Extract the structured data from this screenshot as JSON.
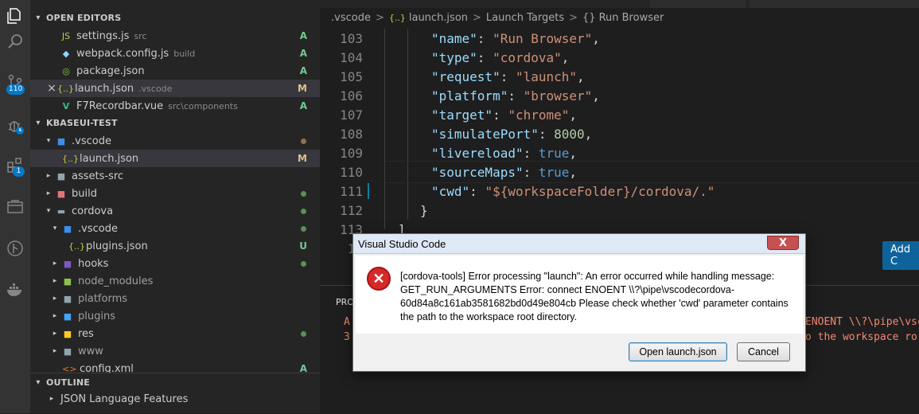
{
  "activity_bar": {
    "scm_badge": "110",
    "extensions_badge": "1"
  },
  "sidebar": {
    "open_editors": {
      "title": "OPEN EDITORS",
      "items": [
        {
          "name": "settings.js",
          "desc": "src",
          "status": "A",
          "icon": "js-file-icon"
        },
        {
          "name": "webpack.config.js",
          "desc": "build",
          "status": "A",
          "icon": "webpack-file-icon"
        },
        {
          "name": "package.json",
          "desc": "",
          "status": "A",
          "icon": "npm-file-icon"
        },
        {
          "name": "launch.json",
          "desc": ".vscode",
          "status": "M",
          "icon": "json-file-icon",
          "close": "×"
        },
        {
          "name": "F7Recordbar.vue",
          "desc": "src\\components",
          "status": "A",
          "icon": "vue-file-icon"
        }
      ]
    },
    "explorer": {
      "title": "KBASEUI-TEST",
      "items": [
        {
          "name": ".vscode",
          "status": "",
          "icon": "vscode-folder-icon"
        },
        {
          "name": "launch.json",
          "status": "M",
          "icon": "json-file-icon"
        },
        {
          "name": "assets-src",
          "status": "",
          "icon": "folder-icon"
        },
        {
          "name": "build",
          "status": "",
          "icon": "build-folder-icon"
        },
        {
          "name": "cordova",
          "status": "",
          "icon": "folder-open-icon"
        },
        {
          "name": ".vscode",
          "status": "",
          "icon": "vscode-folder-icon"
        },
        {
          "name": "plugins.json",
          "status": "U",
          "icon": "json-file-icon"
        },
        {
          "name": "hooks",
          "status": "",
          "icon": "hooks-folder-icon"
        },
        {
          "name": "node_modules",
          "status": "",
          "icon": "node-folder-icon"
        },
        {
          "name": "platforms",
          "status": "",
          "icon": "folder-icon"
        },
        {
          "name": "plugins",
          "status": "",
          "icon": "plugins-folder-icon"
        },
        {
          "name": "res",
          "status": "",
          "icon": "res-folder-icon"
        },
        {
          "name": "www",
          "status": "",
          "icon": "folder-icon"
        },
        {
          "name": "config.xml",
          "status": "A",
          "icon": "xml-file-icon"
        }
      ]
    },
    "outline": {
      "title": "OUTLINE",
      "message": "JSON Language Features"
    }
  },
  "breadcrumb": {
    "items": [
      ".vscode",
      "launch.json",
      "Launch Targets",
      "Run Browser"
    ],
    "sep": ">"
  },
  "code": {
    "lines": [
      {
        "num": "103",
        "key": "\"name\"",
        "value": "\"Run Browser\"",
        "vtype": "s",
        "comma": ","
      },
      {
        "num": "104",
        "key": "\"type\"",
        "value": "\"cordova\"",
        "vtype": "s",
        "comma": ","
      },
      {
        "num": "105",
        "key": "\"request\"",
        "value": "\"launch\"",
        "vtype": "s",
        "comma": ","
      },
      {
        "num": "106",
        "key": "\"platform\"",
        "value": "\"browser\"",
        "vtype": "s",
        "comma": ","
      },
      {
        "num": "107",
        "key": "\"target\"",
        "value": "\"chrome\"",
        "vtype": "s",
        "comma": ","
      },
      {
        "num": "108",
        "key": "\"simulatePort\"",
        "value": "8000",
        "vtype": "n",
        "comma": ","
      },
      {
        "num": "109",
        "key": "\"livereload\"",
        "value": "true",
        "vtype": "b",
        "comma": ","
      },
      {
        "num": "110",
        "key": "\"sourceMaps\"",
        "value": "true",
        "vtype": "b",
        "comma": ","
      },
      {
        "num": "111",
        "key": "\"cwd\"",
        "value": "\"${workspaceFolder}/cordova/.\"",
        "vtype": "s",
        "comma": ""
      }
    ],
    "line112": {
      "num": "112",
      "text": "}"
    },
    "line113": {
      "num": "113",
      "text": "]"
    },
    "line114": {
      "num": "11"
    }
  },
  "add_button": {
    "label": "Add C"
  },
  "panel": {
    "tab": "PRO",
    "err1_left": "A",
    "err2_left": "3",
    "err1_right": "ENOENT \\\\?\\pipe\\vsc",
    "err2_right": "o the workspace ro"
  },
  "dialog": {
    "title": "Visual Studio Code",
    "close": "X",
    "message": "[cordova-tools] Error processing \"launch\": An error occurred while handling message: GET_RUN_ARGUMENTS Error: connect ENOENT \\\\?\\pipe\\vscodecordova-60d84a8c161ab3581682bd0d49e804cb Please check whether 'cwd' parameter contains the path to the workspace root directory.",
    "primary_button": "Open launch.json",
    "cancel_button": "Cancel"
  },
  "colors": {
    "accent": "#007acc",
    "git_added": "#73c991",
    "git_modified": "#e2c08d",
    "error": "#f48771"
  }
}
